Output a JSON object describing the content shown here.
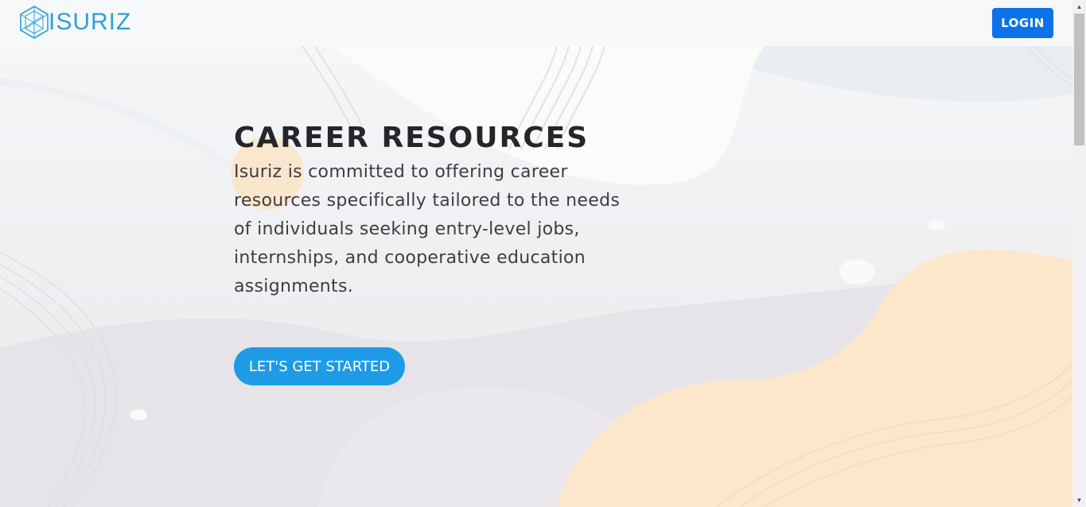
{
  "brand": {
    "name": "ISURIZ",
    "accent_color": "#2f9fd9"
  },
  "header": {
    "login_label": "LOGIN",
    "login_color": "#0d72e8"
  },
  "hero": {
    "title": "CAREER RESOURCES",
    "description": "Isuriz is committed to offering career resources specifically tailored to the needs of individuals seeking entry-level jobs, internships, and cooperative education assignments.",
    "cta_label": "LET'S GET STARTED",
    "cta_color": "#1e9be6",
    "background_icon": "abstract-waves-illustration"
  },
  "scrollbar": {
    "up_icon": "triangle-up-icon",
    "down_icon": "triangle-down-icon"
  }
}
